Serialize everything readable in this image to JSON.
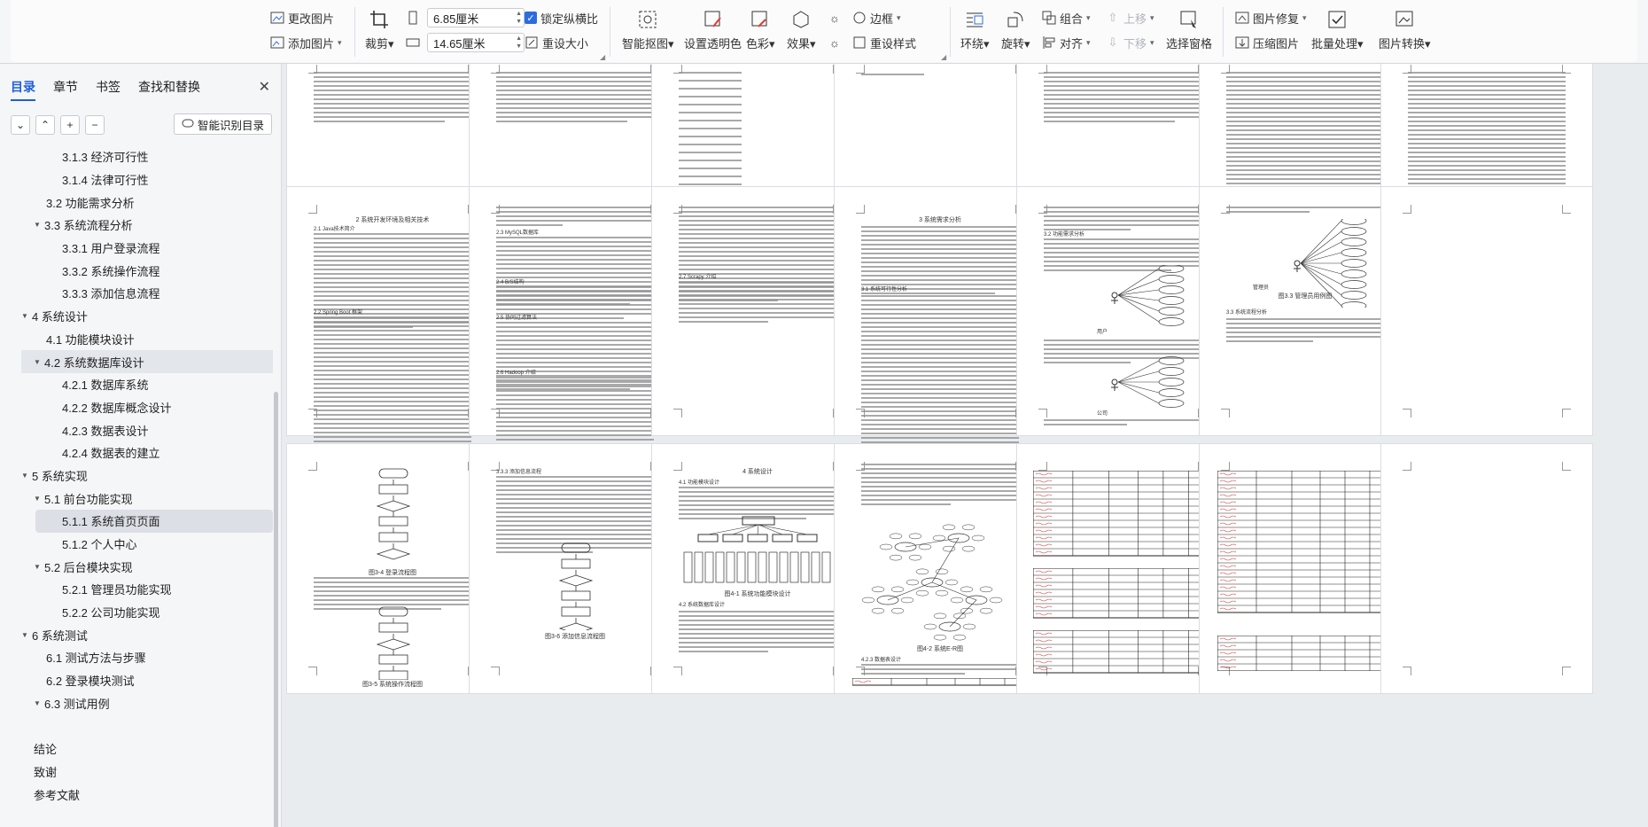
{
  "toolbar": {
    "change_picture": "更改图片",
    "add_picture": "添加图片",
    "crop": "裁剪",
    "width_value": "6.85厘米",
    "height_value": "14.65厘米",
    "lock_ratio": "锁定纵横比",
    "reset_size": "重设大小",
    "smart_cutout": "智能抠图",
    "set_transparent": "设置透明色",
    "color": "色彩",
    "effects": "效果",
    "border": "边框",
    "reset_style": "重设样式",
    "wrap": "环绕",
    "rotate": "旋转",
    "group": "组合",
    "align": "对齐",
    "bring_forward": "上移",
    "send_backward": "下移",
    "selection_pane": "选择窗格",
    "picture_repair": "图片修复",
    "compress": "压缩图片",
    "batch_process": "批量处理",
    "picture_convert": "图片转换"
  },
  "sidebar": {
    "tabs": [
      "目录",
      "章节",
      "书签",
      "查找和替换"
    ],
    "smart_toc": "智能识别目录",
    "toc": [
      {
        "label": "3.1.3  经济可行性",
        "level": 3
      },
      {
        "label": "3.1.4  法律可行性",
        "level": 3
      },
      {
        "label": "3.2  功能需求分析",
        "level": 2
      },
      {
        "label": "3.3  系统流程分析",
        "level": 2,
        "expanded": true
      },
      {
        "label": "3.3.1  用户登录流程",
        "level": 3
      },
      {
        "label": "3.3.2  系统操作流程",
        "level": 3
      },
      {
        "label": "3.3.3  添加信息流程",
        "level": 3
      },
      {
        "label": "4 系统设计",
        "level": 1,
        "expanded": true
      },
      {
        "label": "4.1  功能模块设计",
        "level": 2
      },
      {
        "label": "4.2  系统数据库设计",
        "level": 2,
        "expanded": true,
        "highlight": true
      },
      {
        "label": "4.2.1  数据库系统",
        "level": 3
      },
      {
        "label": "4.2.2  数据库概念设计",
        "level": 3
      },
      {
        "label": "4.2.3  数据表设计",
        "level": 3
      },
      {
        "label": "4.2.4  数据表的建立",
        "level": 3
      },
      {
        "label": "5 系统实现",
        "level": 1,
        "expanded": true
      },
      {
        "label": "5.1 前台功能实现",
        "level": 2,
        "expanded": true
      },
      {
        "label": "5.1.1 系统首页页面",
        "level": 3,
        "selected": true
      },
      {
        "label": "5.1.2 个人中心",
        "level": 3
      },
      {
        "label": "5.2 后台模块实现",
        "level": 2,
        "expanded": true
      },
      {
        "label": "5.2.1 管理员功能实现",
        "level": 3
      },
      {
        "label": "5.2.2 公司功能实现",
        "level": 3
      },
      {
        "label": "6 系统测试",
        "level": 1,
        "expanded": true
      },
      {
        "label": "6.1    测试方法与步骤",
        "level": 2
      },
      {
        "label": "6.2    登录模块测试",
        "level": 2
      },
      {
        "label": "6.3    测试用例",
        "level": 2,
        "expanded": true
      },
      {
        "label": "",
        "level": 0
      },
      {
        "label": "结论",
        "level": 0
      },
      {
        "label": "致谢",
        "level": 0
      },
      {
        "label": "参考文献",
        "level": 0
      }
    ]
  },
  "pages": {
    "p2_title": "2  系统开发环境及相关技术",
    "p2_h1": "2.1 Java技术简介",
    "p2_h2": "2.2 Spring Boot 框架",
    "p3_h1": "2.3 MySQL数据库",
    "p3_h2": "2.4 B/S结构",
    "p3_h3": "2.5 协同过滤算法",
    "p3_h4": "2.6 Hadoop 介绍",
    "p4_h1": "2.7 Scrapy 介绍",
    "p5_title": "3 系统需求分析",
    "p5_h1": "3.1 系统可行性分析",
    "p6_h1": "3.2 功能需求分析",
    "p7_h1": "3.3 系统流程分析",
    "p7_cap": "图3.3 管理员用例图",
    "p9_cap1": "图3-4 登录流程图",
    "p9_cap2": "图3-5 系统操作流程图",
    "p10_h1": "3.3.3 添加信息流程",
    "p10_cap": "图3-6 添加信息流程图",
    "p11_title": "4 系统设计",
    "p11_h1": "4.1 功能模块设计",
    "p11_cap": "图4-1 系统功能模块设计",
    "p11_h2": "4.2 系统数据库设计",
    "p12_cap": "图4-2 系统E-R图",
    "p12_h1": "4.2.3 数据表设计",
    "user_label": "用户",
    "company_label": "公司",
    "admin_label": "管理员"
  },
  "colors": {
    "accent": "#1f5fd6",
    "check": "#2d6cdf",
    "selected_bg": "#dcdfe5",
    "ribbon_bg": "#f5f6f8"
  }
}
